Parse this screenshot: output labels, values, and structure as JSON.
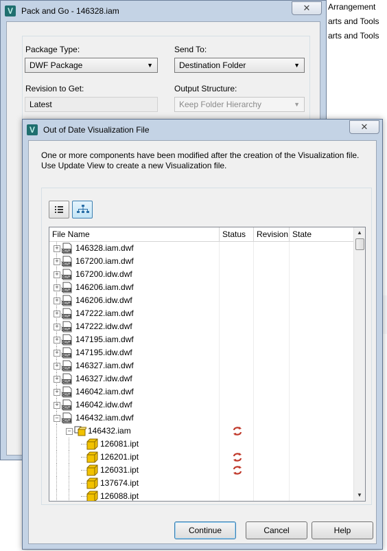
{
  "background": {
    "items": [
      "Arrangement",
      "arts and Tools",
      "arts and Tools"
    ]
  },
  "pack_and_go": {
    "title": "Pack and Go - 146328.iam",
    "package_type_label": "Package Type:",
    "package_type_value": "DWF Package",
    "send_to_label": "Send To:",
    "send_to_value": "Destination Folder",
    "revision_label": "Revision to Get:",
    "revision_value": "Latest",
    "output_structure_label": "Output Structure:",
    "output_structure_value": "Keep Folder Hierarchy",
    "close_glyph": "✕"
  },
  "dialog": {
    "title": "Out of Date Visualization File",
    "message": "One or more components have been modified after the creation of the Visualization file. Use Update View to create a new Visualization file.",
    "close_glyph": "✕",
    "columns": [
      "File Name",
      "Status",
      "Revision",
      "State"
    ],
    "rows": [
      {
        "name": "146328.iam.dwf",
        "level": 0,
        "type": "dwf",
        "expand": "+",
        "status": false
      },
      {
        "name": "167200.iam.dwf",
        "level": 0,
        "type": "dwf",
        "expand": "+",
        "status": false
      },
      {
        "name": "167200.idw.dwf",
        "level": 0,
        "type": "dwf",
        "expand": "+",
        "status": false
      },
      {
        "name": "146206.iam.dwf",
        "level": 0,
        "type": "dwf",
        "expand": "+",
        "status": false
      },
      {
        "name": "146206.idw.dwf",
        "level": 0,
        "type": "dwf",
        "expand": "+",
        "status": false
      },
      {
        "name": "147222.iam.dwf",
        "level": 0,
        "type": "dwf",
        "expand": "+",
        "status": false
      },
      {
        "name": "147222.idw.dwf",
        "level": 0,
        "type": "dwf",
        "expand": "+",
        "status": false
      },
      {
        "name": "147195.iam.dwf",
        "level": 0,
        "type": "dwf",
        "expand": "+",
        "status": false
      },
      {
        "name": "147195.idw.dwf",
        "level": 0,
        "type": "dwf",
        "expand": "+",
        "status": false
      },
      {
        "name": "146327.iam.dwf",
        "level": 0,
        "type": "dwf",
        "expand": "+",
        "status": false
      },
      {
        "name": "146327.idw.dwf",
        "level": 0,
        "type": "dwf",
        "expand": "+",
        "status": false
      },
      {
        "name": "146042.iam.dwf",
        "level": 0,
        "type": "dwf",
        "expand": "+",
        "status": false
      },
      {
        "name": "146042.idw.dwf",
        "level": 0,
        "type": "dwf",
        "expand": "+",
        "status": false
      },
      {
        "name": "146432.iam.dwf",
        "level": 0,
        "type": "dwf",
        "expand": "-",
        "status": false
      },
      {
        "name": "146432.iam",
        "level": 1,
        "type": "iam",
        "expand": "-",
        "status": true
      },
      {
        "name": "126081.ipt",
        "level": 2,
        "type": "ipt",
        "expand": "",
        "status": false
      },
      {
        "name": "126201.ipt",
        "level": 2,
        "type": "ipt",
        "expand": "",
        "status": true
      },
      {
        "name": "126031.ipt",
        "level": 2,
        "type": "ipt",
        "expand": "",
        "status": true
      },
      {
        "name": "137674.ipt",
        "level": 2,
        "type": "ipt",
        "expand": "",
        "status": false
      },
      {
        "name": "126088.ipt",
        "level": 2,
        "type": "ipt",
        "expand": "",
        "status": false
      }
    ],
    "buttons": {
      "continue": "Continue",
      "cancel": "Cancel",
      "help": "Help"
    },
    "colors": {
      "accent": "#3c7fb1",
      "status_icon": "#c0392b",
      "ipt_icon": "#f2c200"
    }
  }
}
